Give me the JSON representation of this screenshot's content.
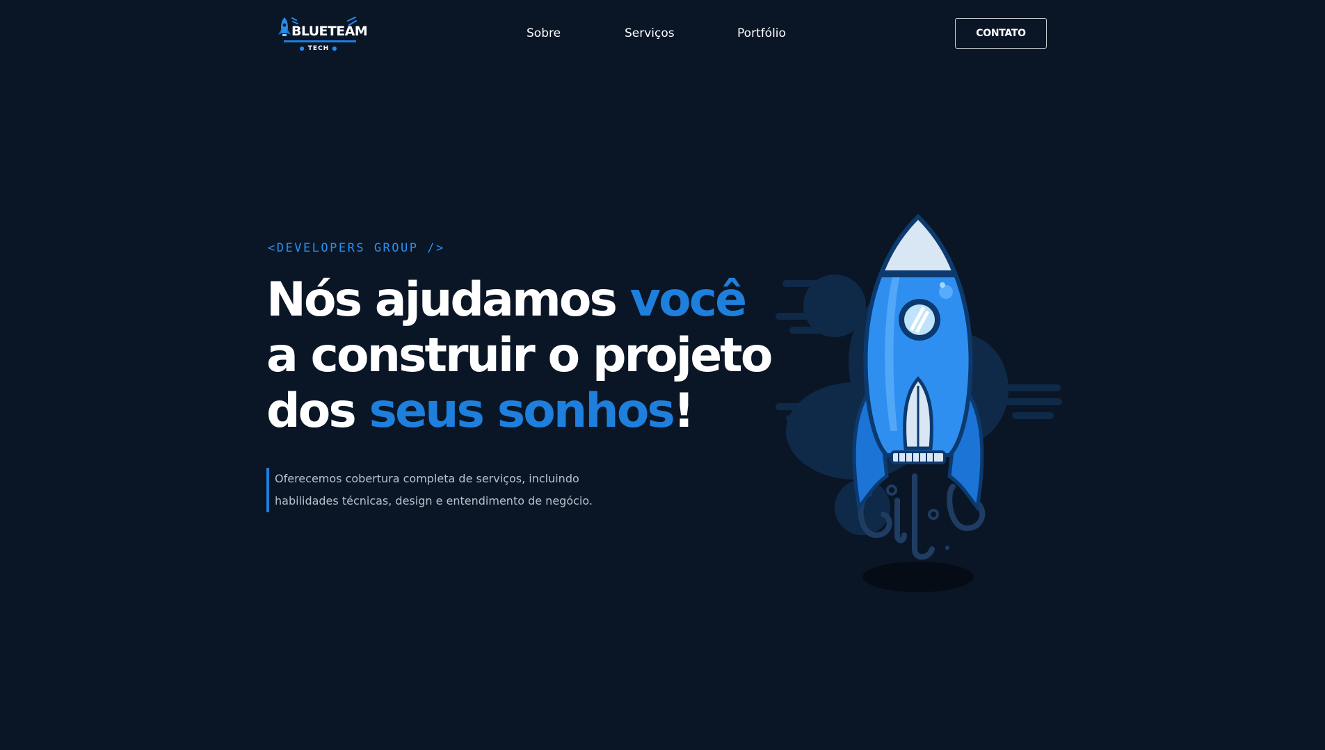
{
  "header": {
    "logo": {
      "name": "BLUETEAM",
      "sub": "TECH"
    },
    "nav": [
      {
        "label": "Sobre"
      },
      {
        "label": "Serviços"
      },
      {
        "label": "Portfólio"
      }
    ],
    "contact_label": "CONTATO"
  },
  "hero": {
    "eyebrow": "<DEVELOPERS GROUP />",
    "headline": {
      "line1_a": "Nós ajudamos ",
      "line1_b": "você",
      "line2": "a construir o projeto",
      "line3_a": "dos ",
      "line3_b": "seus sonhos",
      "line3_c": "!"
    },
    "description": {
      "line1": "Oferecemos cobertura completa de serviços, incluindo",
      "line2": "habilidades técnicas, design e entendimento de negócio."
    },
    "illustration_icon": "rocket-illustration-icon"
  },
  "colors": {
    "background": "#0a1626",
    "accent": "#1e7fdc",
    "text": "#ffffff",
    "muted_text": "#b8c0cc"
  }
}
